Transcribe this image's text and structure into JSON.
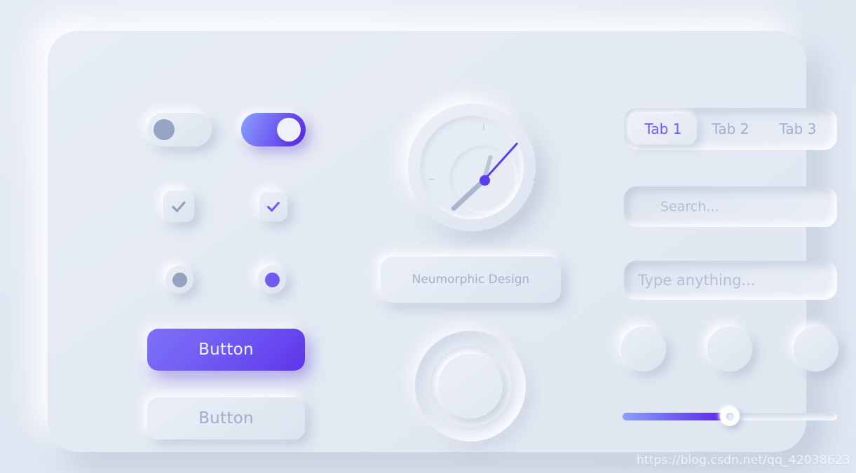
{
  "theme": {
    "background": "#e4eaf3",
    "card_surface": "#e7ecf5",
    "accent": "#6f5bf0",
    "accent_gradient_start": "#8aa1ff",
    "accent_gradient_end": "#5b21e8",
    "muted_text": "#a3b0cb",
    "grey_control": "#97a5c4"
  },
  "controls": {
    "toggle_off": {
      "name": "toggle-off",
      "state": "off"
    },
    "toggle_on": {
      "name": "toggle-on",
      "state": "on"
    },
    "checkbox_grey": {
      "name": "checkbox-grey",
      "checked": true,
      "check_color": "#93a0bd"
    },
    "checkbox_purple": {
      "name": "checkbox-purple",
      "checked": true,
      "check_color": "#6f5bf0"
    },
    "radio_grey": {
      "name": "radio-grey",
      "selected": true,
      "dot_color": "#95a3c0"
    },
    "radio_purple": {
      "name": "radio-purple",
      "selected": true,
      "dot_color": "#6f5bf0"
    }
  },
  "buttons": {
    "primary_label": "Button",
    "secondary_label": "Button"
  },
  "clock": {
    "hour_hand_angle": 137,
    "minute_hand_angle": -74,
    "second_hand_angle": -48,
    "ticks": [
      "12",
      "3",
      "6",
      "9"
    ]
  },
  "label_card": {
    "text": "Neumorphic Design"
  },
  "knob": {
    "name": "rotary-knob"
  },
  "tabs": {
    "items": [
      {
        "label": "Tab 1",
        "active": true
      },
      {
        "label": "Tab 2",
        "active": false
      },
      {
        "label": "Tab 3",
        "active": false
      }
    ]
  },
  "inputs": {
    "search": {
      "placeholder": "Search...",
      "value": ""
    },
    "text": {
      "placeholder": "Type anything...",
      "value": ""
    }
  },
  "circle_buttons": [
    {
      "name": "circle-button-1",
      "label": ""
    },
    {
      "name": "circle-button-2",
      "label": ""
    },
    {
      "name": "circle-button-3",
      "label": ""
    }
  ],
  "slider": {
    "value": 50,
    "min": 0,
    "max": 100
  },
  "watermark": {
    "text": "https://blog.csdn.net/qq_42038623"
  }
}
